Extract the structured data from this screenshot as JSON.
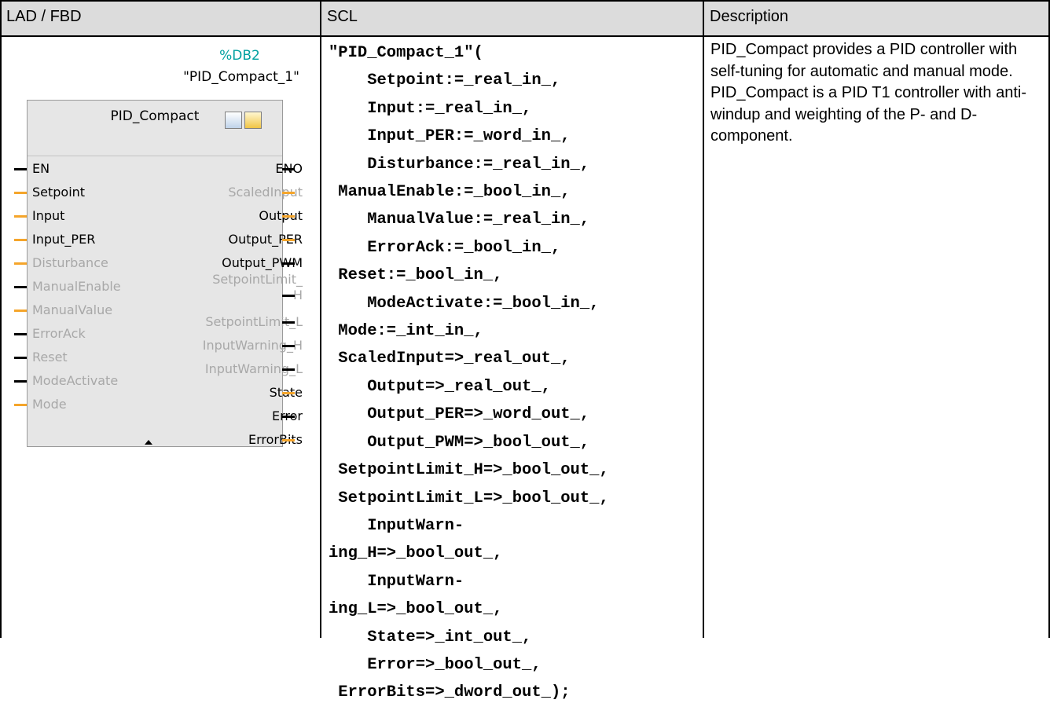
{
  "table": {
    "headers": [
      "LAD / FBD",
      "SCL",
      "Description"
    ]
  },
  "fbd": {
    "db_number": "%DB2",
    "instance_name": "\"PID_Compact_1\"",
    "block_name": "PID_Compact",
    "icons": [
      "block-info-icon",
      "warning-icon"
    ],
    "inputs": [
      {
        "label": "EN",
        "dim": false,
        "tick": "black"
      },
      {
        "label": "Setpoint",
        "dim": false,
        "tick": "orange"
      },
      {
        "label": "Input",
        "dim": false,
        "tick": "orange"
      },
      {
        "label": "Input_PER",
        "dim": false,
        "tick": "orange"
      },
      {
        "label": "Disturbance",
        "dim": true,
        "tick": "orange"
      },
      {
        "label": "ManualEnable",
        "dim": true,
        "tick": "black"
      },
      {
        "label": "ManualValue",
        "dim": true,
        "tick": "orange"
      },
      {
        "label": "ErrorAck",
        "dim": true,
        "tick": "black"
      },
      {
        "label": "Reset",
        "dim": true,
        "tick": "black"
      },
      {
        "label": "ModeActivate",
        "dim": true,
        "tick": "black"
      },
      {
        "label": "Mode",
        "dim": true,
        "tick": "orange"
      }
    ],
    "outputs": [
      {
        "label": "ENO",
        "dim": false,
        "tick": "black"
      },
      {
        "label": "ScaledInput",
        "dim": true,
        "tick": "orange"
      },
      {
        "label": "Output",
        "dim": false,
        "tick": "orange"
      },
      {
        "label": "Output_PER",
        "dim": false,
        "tick": "orange"
      },
      {
        "label": "Output_PWM",
        "dim": false,
        "tick": "black"
      },
      {
        "label": "SetpointLimit_",
        "dim": true,
        "tick": "none"
      },
      {
        "label": "H",
        "dim": true,
        "tick": "black"
      },
      {
        "label": "SetpointLimit_L",
        "dim": true,
        "tick": "black"
      },
      {
        "label": "InputWarning_H",
        "dim": true,
        "tick": "black"
      },
      {
        "label": "InputWarning_L",
        "dim": true,
        "tick": "black"
      },
      {
        "label": "State",
        "dim": false,
        "tick": "orange"
      },
      {
        "label": "Error",
        "dim": false,
        "tick": "black"
      },
      {
        "label": "ErrorBits",
        "dim": false,
        "tick": "orange"
      }
    ],
    "colors": {
      "orange_pin": "#f5a52b",
      "black_pin": "#000000",
      "db_label": "#00a0a0"
    }
  },
  "scl": {
    "lines": [
      "\"PID_Compact_1\"(",
      "    Setpoint:=_real_in_,",
      "    Input:=_real_in_,",
      "    Input_PER:=_word_in_,",
      "    Disturbance:=_real_in_,",
      " ManualEnable:=_bool_in_,",
      "    ManualValue:=_real_in_,",
      "    ErrorAck:=_bool_in_,",
      " Reset:=_bool_in_,",
      "    ModeActivate:=_bool_in_,",
      " Mode:=_int_in_,",
      " ScaledInput=>_real_out_,",
      "    Output=>_real_out_,",
      "    Output_PER=>_word_out_,",
      "    Output_PWM=>_bool_out_,",
      " SetpointLimit_H=>_bool_out_,",
      " SetpointLimit_L=>_bool_out_,",
      "    InputWarn-",
      "ing_H=>_bool_out_,",
      "    InputWarn-",
      "ing_L=>_bool_out_,",
      "    State=>_int_out_,",
      "    Error=>_bool_out_,",
      " ErrorBits=>_dword_out_);"
    ]
  },
  "description": {
    "text": "PID_Compact provides a PID controller with self-tuning for automatic and manual mode. PID_Compact is a PID T1 controller with anti-windup and weighting of the P- and D-component."
  }
}
